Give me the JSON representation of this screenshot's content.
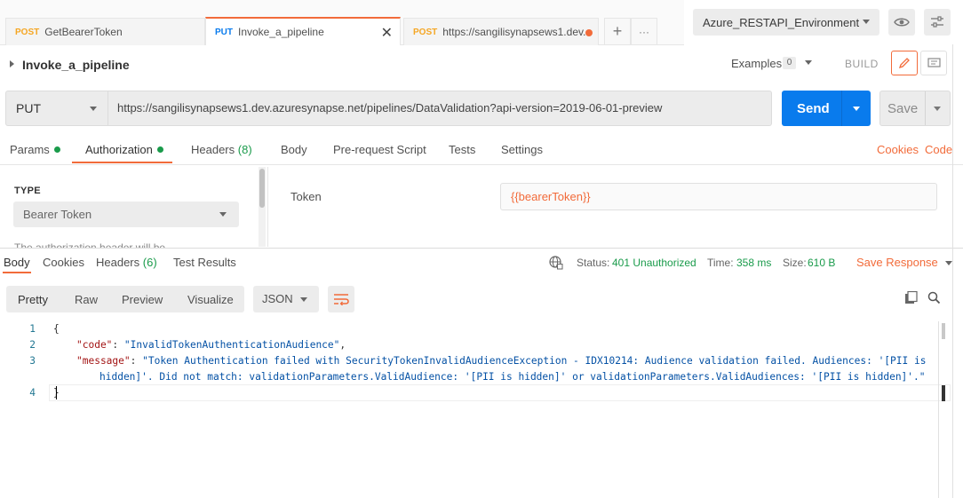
{
  "tabs": [
    {
      "method": "POST",
      "name": "GetBearerToken",
      "color": "#f5a623"
    },
    {
      "method": "PUT",
      "name": "Invoke_a_pipeline",
      "color": "#097bed",
      "active": true
    },
    {
      "method": "POST",
      "name": "https://sangilisynapsews1.dev...",
      "color": "#f5a623",
      "unsaved": true
    }
  ],
  "tabbar": {
    "add_label": "+",
    "more_label": "···"
  },
  "environment": {
    "selected": "Azure_RESTAPI_Environment"
  },
  "request": {
    "title": "Invoke_a_pipeline",
    "examples_label": "Examples",
    "examples_count": "0",
    "build_label": "BUILD",
    "method": "PUT",
    "url": "https://sangilisynapsews1.dev.azuresynapse.net/pipelines/DataValidation?api-version=2019-06-01-preview",
    "send_label": "Send",
    "save_label": "Save"
  },
  "request_tabs": {
    "params": "Params",
    "authorization": "Authorization",
    "headers": "Headers",
    "headers_count": "(8)",
    "body": "Body",
    "prerequest": "Pre-request Script",
    "tests": "Tests",
    "settings": "Settings",
    "cookies": "Cookies",
    "code": "Code"
  },
  "auth": {
    "type_label": "TYPE",
    "type_value": "Bearer Token",
    "note": "The authorization header will be",
    "token_label": "Token",
    "token_value": "{{bearerToken}}"
  },
  "response": {
    "tabs": {
      "body": "Body",
      "cookies": "Cookies",
      "headers": "Headers",
      "headers_count": "(6)",
      "test_results": "Test Results"
    },
    "status_label": "Status:",
    "status_value": "401 Unauthorized",
    "time_label": "Time:",
    "time_value": "358 ms",
    "size_label": "Size:",
    "size_value": "610 B",
    "save_response": "Save Response",
    "views": [
      "Pretty",
      "Raw",
      "Preview",
      "Visualize"
    ],
    "format": "JSON"
  },
  "code": {
    "line_numbers": [
      "1",
      "2",
      "3",
      "4"
    ],
    "open_brace": "{",
    "code_key": "\"code\"",
    "code_value": "\"InvalidTokenAuthenticationAudience\"",
    "message_key": "\"message\"",
    "message_value_1": "\"Token Authentication failed with SecurityTokenInvalidAudienceException - IDX10214: Audience validation failed. Audiences: '[PII is",
    "message_value_2": "hidden]'. Did not match: validationParameters.ValidAudience: '[PII is hidden]' or validationParameters.ValidAudiences: '[PII is hidden]'.\"",
    "close_brace": "}"
  }
}
